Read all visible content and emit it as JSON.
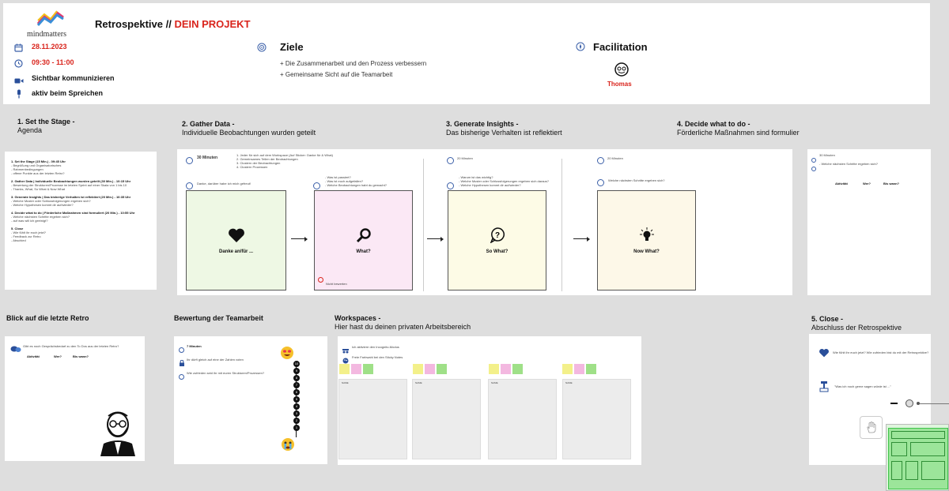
{
  "header": {
    "logo_text": "mindmatters",
    "title_prefix": "Retrospektive // ",
    "title_project": "DEIN PROJEKT",
    "date": "28.11.2023",
    "time": "09:30 - 11:00",
    "info1": "Sichtbar kommunizieren",
    "info2": "aktiv beim Spreichen",
    "goals_title": "Ziele",
    "goal1": "+ Die Zusammenarbeit und den Prozess verbessern",
    "goal2": "+ Gemeinsame Sicht auf die Teamarbeit",
    "facilitation_title": "Facilitation",
    "facilitator": "Thomas"
  },
  "sections": {
    "s1_title": "1. Set the Stage -",
    "s1_sub": "Agenda",
    "s2_title": "2. Gather Data -",
    "s2_sub": "Individuelle Beobachtungen wurden geteilt",
    "s3_title": "3. Generate Insights -",
    "s3_sub": "Das bisherige Verhalten  ist reflektiert",
    "s4_title": "4. Decide what to do -",
    "s4_sub": "Förderliche Maßnahmen sind formulier",
    "blick_title": "Blick auf die letzte Retro",
    "bewertung_title": "Bewertung der Teamarbeit",
    "ws_title": "Workspaces -",
    "ws_sub": "Hier hast du deinen privaten Arbeitsbereich",
    "s5_title": "5. Close -",
    "s5_sub": "Abschluss der Retrospektive"
  },
  "agenda": {
    "items": [
      {
        "head": "1. Set the Stage (15 Min.) - 09:45 Uhr",
        "lines": [
          "- Begrüßung und Organisatorisches",
          "- Rahmenbedingungen",
          "- offene Punkte aus der letzten Retro?"
        ]
      },
      {
        "head": "2. Gather Data | Individuelle Beobachtungen wurden geteilt (30 Min.) - 10:15 Uhr",
        "lines": [
          "- Bewertung der Strukturen/Prozesse im letzten Sprint auf einer Skala von 1 bis 10",
          "- Thanks, What, So What & Now What"
        ]
      },
      {
        "head": "3. Generate Insights | Das bisherige Verhalten ist reflektiert (20 Min.) - 10:35 Uhr",
        "lines": [
          "- Welche Muster oder Schlussfolgerungen ergeben sich?",
          "- Welche Hypothesen kommt dir auf/wieder?"
        ]
      },
      {
        "head": "4. Decide what to do | Förderliche Maßnahmen sind formuliert (20 Min.) - 10:55 Uhr",
        "lines": [
          "- Welche nächsten Schritte ergeben sich?",
          "- auf was will ich geeinigt?"
        ]
      },
      {
        "head": "5. Close",
        "lines": [
          "- Wie fühlt ihr euch jetzt?",
          "- Feedback zur Retro",
          "- Abschied"
        ]
      }
    ]
  },
  "gather": {
    "minutes": "30 Minuten",
    "steps": [
      "1. Jeder für sich auf dem Workspace (Auf Sticker: Danke für & What)",
      "2. Gemeinsames Teilen der Beobachtungen",
      "3. Clustern der Beobachtungen",
      "4. Clustern Prozessen"
    ],
    "thanks_question": "Danke, darüber habe ich mich gefreut!",
    "what_questions": [
      "- Was ist passiert?",
      "- Was ist euch aufgefallen?",
      "- Welche Beobachtungen habt du gemacht?"
    ],
    "thanks_label": "Danke an/für ...",
    "what_label": "What?",
    "note": "Nicht bewerten"
  },
  "insights": {
    "minutes": "20 Minuten",
    "questions": [
      "- Warum ist das wichtig?",
      "- Welche Muster oder Schlussfolgerungen ergeben sich daraus?",
      "- Welche Hypothesen kommt dir auf/wieder?"
    ],
    "label": "So What?"
  },
  "decide": {
    "minutes": "20 Minuten",
    "question": "Welche nächsten Schritte ergeben sich?",
    "label": "Now What?"
  },
  "s4card": {
    "minutes": "30 Minuten",
    "question": "- Welche nächsten Schritte ergeben sich?",
    "cols": [
      "Aktivität",
      "Wer?",
      "Bis wann?"
    ]
  },
  "blick": {
    "question": "Gibt es noch Gesprächsbedarf zu den To Dos aus der letzten Retro?",
    "cols": [
      "Aktivität",
      "Wer?",
      "Bis wann?"
    ]
  },
  "bewertung": {
    "minutes": "7 Minuten",
    "line1": "Ihr dürft gleich auf eine der Zahlen voten",
    "line2": "Wie zufrieden seid ihr mit euren Strukturen/Prozessen?",
    "scale": [
      "10",
      "9",
      "8",
      "7",
      "6",
      "5",
      "4",
      "3",
      "2",
      "1"
    ]
  },
  "workspaces": {
    "line1": "Ich aktiviere den Incognito-Modus",
    "line2": "Freie Farbwahl bei den Sticky Notes",
    "cols": [
      "NAME",
      "NAME",
      "NAME",
      "NAME"
    ]
  },
  "close": {
    "q1": "Wie fühlt ihr euch jetzt? Wie zufrieden bist du mit der Retrospektive?",
    "q2": "\"Was ich noch gerne sagen würde ist ...\""
  },
  "colors": {
    "accent_red": "#d9241c",
    "icon_blue": "#3a5fa8",
    "green_card": "#eef8e4",
    "pink_card": "#fbe8f5",
    "yellow_card": "#fdfbe6",
    "cream_card": "#fdf8e8"
  }
}
